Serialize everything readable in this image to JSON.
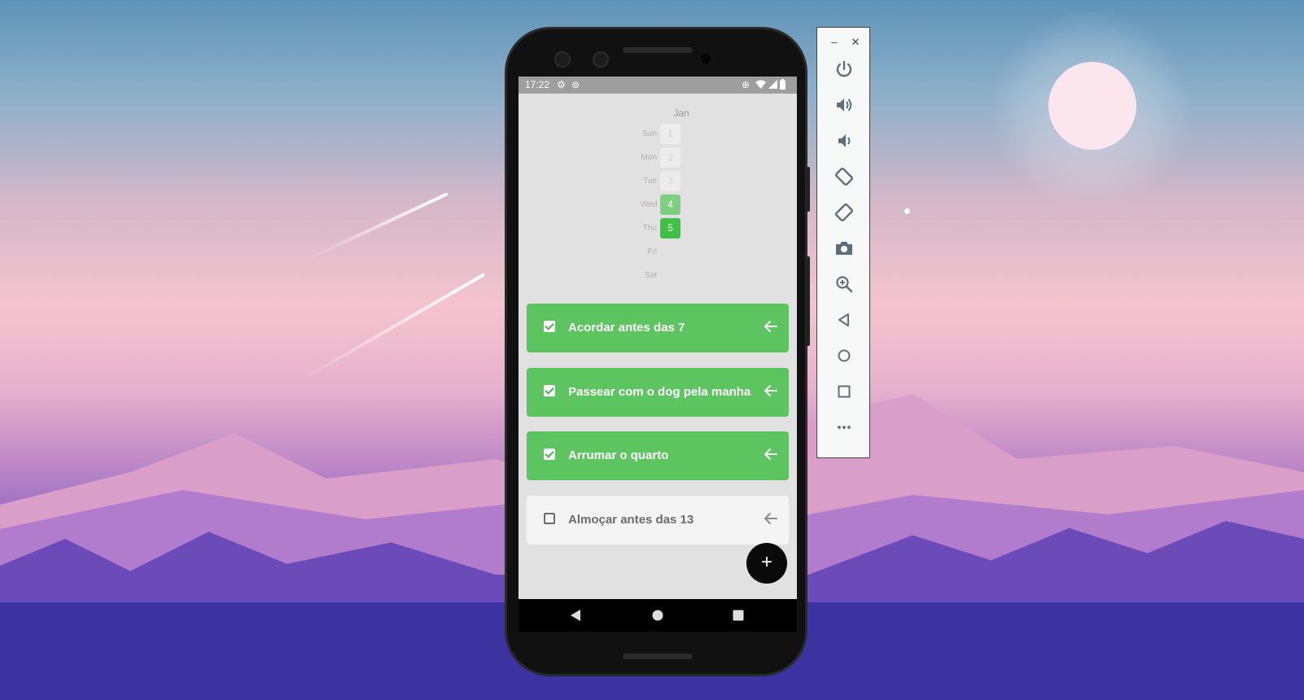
{
  "status_bar": {
    "time": "17:22"
  },
  "calendar": {
    "month": "Jan",
    "days": [
      {
        "dow": "Sun",
        "num": "1",
        "state": "empty"
      },
      {
        "dow": "Mon",
        "num": "2",
        "state": "empty"
      },
      {
        "dow": "Tue",
        "num": "3",
        "state": "empty"
      },
      {
        "dow": "Wed",
        "num": "4",
        "state": "light"
      },
      {
        "dow": "Thu",
        "num": "5",
        "state": "full"
      },
      {
        "dow": "Fri",
        "num": "",
        "state": "none"
      },
      {
        "dow": "Sat",
        "num": "",
        "state": "none"
      }
    ]
  },
  "tasks": [
    {
      "label": "Acordar antes das 7",
      "done": true
    },
    {
      "label": "Passear com o dog pela manha",
      "done": true
    },
    {
      "label": "Arrumar o quarto",
      "done": true
    },
    {
      "label": "Almoçar antes das 13",
      "done": false
    }
  ],
  "fab": {
    "label": "+"
  },
  "colors": {
    "done": "#5cc55f",
    "todo": "#f4f4f4",
    "status_bar": "#9e9e9e",
    "screen_bg": "#e1e1e1"
  },
  "emulator_toolbar": {
    "window_controls": [
      "minimize-icon",
      "close-icon"
    ],
    "buttons": [
      "power-icon",
      "volume-up-icon",
      "volume-down-icon",
      "rotate-left-icon",
      "rotate-right-icon",
      "camera-icon",
      "zoom-icon",
      "back-icon",
      "home-icon",
      "overview-icon",
      "more-icon"
    ]
  }
}
